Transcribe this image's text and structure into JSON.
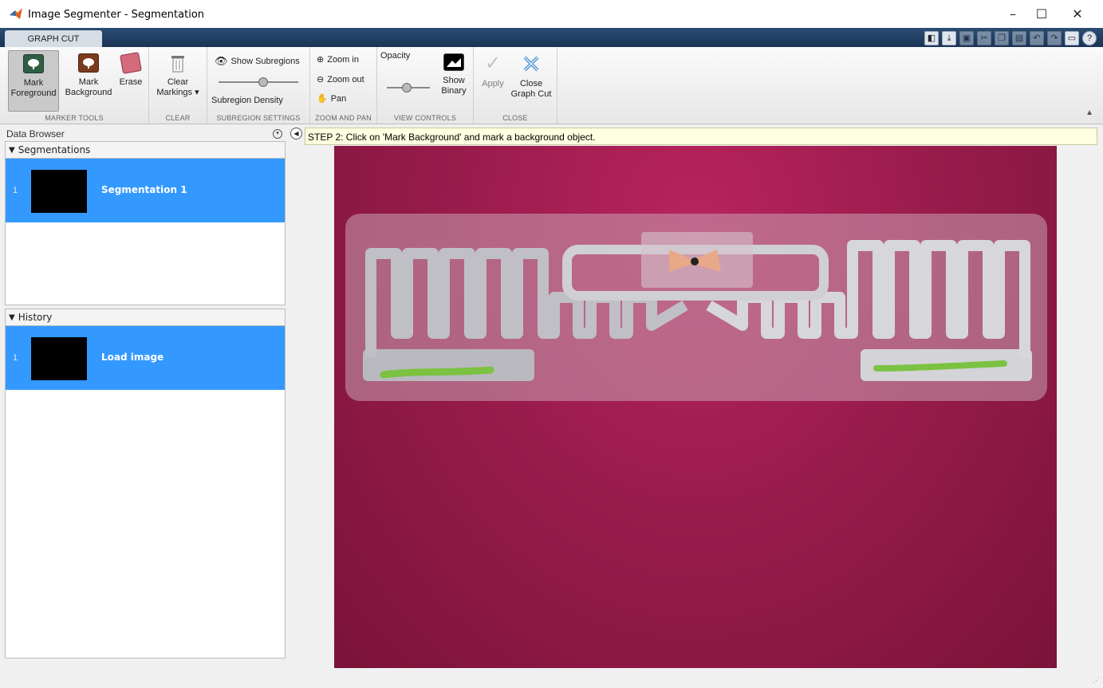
{
  "window": {
    "title": "Image Segmenter - Segmentation",
    "minimize": "–",
    "maximize": "☐",
    "close": "✕"
  },
  "ribbon": {
    "tab": "GRAPH CUT",
    "marker_tools": {
      "label": "MARKER TOOLS",
      "mark_foreground": [
        "Mark",
        "Foreground"
      ],
      "mark_background": [
        "Mark",
        "Background"
      ],
      "erase": "Erase"
    },
    "clear": {
      "label": "CLEAR",
      "clear_markings": [
        "Clear",
        "Markings ▾"
      ]
    },
    "subregion": {
      "label": "SUBREGION SETTINGS",
      "show_subregions": "Show Subregions",
      "density": "Subregion Density",
      "density_level": 0.55
    },
    "zoom": {
      "label": "ZOOM AND PAN",
      "zoom_in": "Zoom in",
      "zoom_out": "Zoom out",
      "pan": "Pan"
    },
    "view": {
      "label": "VIEW CONTROLS",
      "opacity": "Opacity",
      "opacity_level": 0.45,
      "show_binary": [
        "Show",
        "Binary"
      ]
    },
    "close": {
      "label": "CLOSE",
      "apply": "Apply",
      "close_graph_cut": [
        "Close",
        "Graph Cut"
      ]
    }
  },
  "data_browser": {
    "title": "Data Browser",
    "segmentations": {
      "header": "Segmentations",
      "items": [
        {
          "num": "1",
          "label": "Segmentation 1"
        }
      ]
    },
    "history": {
      "header": "History",
      "items": [
        {
          "num": "1",
          "label": "Load image"
        }
      ]
    }
  },
  "hint": "STEP 2: Click on 'Mark Background' and mark a background object.",
  "colors": {
    "selection": "#3399ff",
    "background_magenta": "#9a1c4c",
    "marker_green": "#7cc242",
    "ribbon_dark": "#1a3356"
  }
}
